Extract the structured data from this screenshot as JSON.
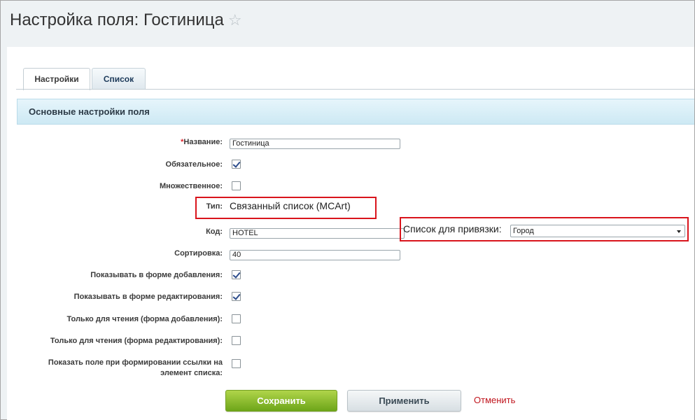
{
  "page": {
    "title": "Настройка поля: Гостиница",
    "star_icon": "☆"
  },
  "tabs": [
    {
      "label": "Настройки",
      "active": true
    },
    {
      "label": "Список",
      "active": false
    }
  ],
  "section": {
    "title": "Основные настройки поля"
  },
  "form": {
    "name": {
      "required_mark": "*",
      "label": "Название:",
      "value": "Гостиница"
    },
    "required": {
      "label": "Обязательное:",
      "checked": true
    },
    "multiple": {
      "label": "Множественное:",
      "checked": false
    },
    "type": {
      "label": "Тип:",
      "value": "Связанный список (MCArt)"
    },
    "code": {
      "label": "Код:",
      "value": "HOTEL"
    },
    "binding": {
      "label": "Список для привязки:",
      "selected": "Город"
    },
    "sort": {
      "label": "Сортировка:",
      "value": "40"
    },
    "show_add": {
      "label": "Показывать в форме добавления:",
      "checked": true
    },
    "show_edit": {
      "label": "Показывать в форме редактирования:",
      "checked": true
    },
    "readonly_add": {
      "label": "Только для чтения (форма добавления):",
      "checked": false
    },
    "readonly_edit": {
      "label": "Только для чтения (форма редактирования):",
      "checked": false
    },
    "show_link": {
      "label": "Показать поле при формировании ссылки на элемент списка:",
      "checked": false
    }
  },
  "buttons": {
    "save": "Сохранить",
    "apply": "Применить",
    "cancel": "Отменить"
  },
  "colors": {
    "highlight_box": "#d9141c",
    "save_button": "#7db422",
    "cancel_link": "#c0151d",
    "required_mark": "#e0252e"
  }
}
